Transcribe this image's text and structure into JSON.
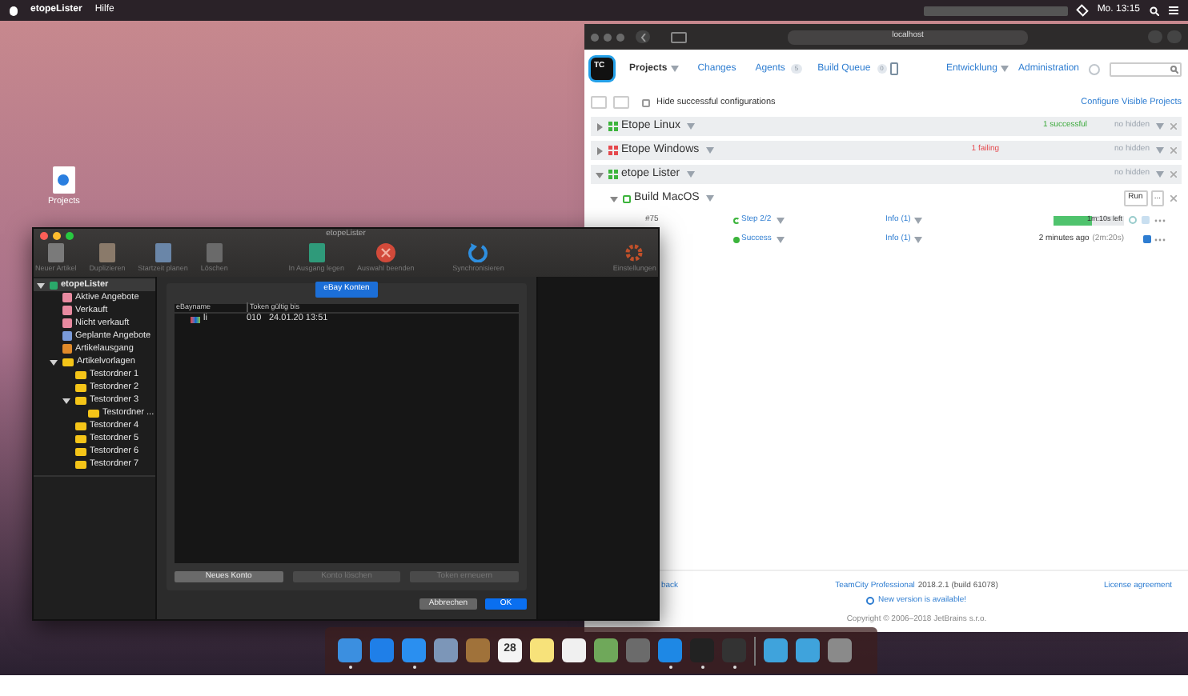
{
  "menu_bar": {
    "app": "etopeLister",
    "items": [
      "Hilfe"
    ],
    "clock": "Mo. 13:15"
  },
  "desktop_icon": {
    "label": "Projects"
  },
  "browser": {
    "address": "localhost",
    "logo": "TC",
    "nav": [
      {
        "label": "Projects",
        "selected": true,
        "dropdown": true
      },
      {
        "label": "Changes",
        "selected": false,
        "dropdown": false
      },
      {
        "label": "Agents",
        "selected": false,
        "dropdown": false,
        "badge": "5"
      },
      {
        "label": "Build Queue",
        "selected": false,
        "dropdown": false,
        "badge": "0"
      }
    ],
    "nav_right": [
      {
        "label": "Entwicklung",
        "dropdown": true
      },
      {
        "label": "Administration",
        "dropdown": false
      }
    ],
    "hide_successful": {
      "label": "Hide successful configurations",
      "checked": false
    },
    "configure_link": "Configure Visible Projects",
    "projects": [
      {
        "name": "Etope Linux",
        "kind": "success",
        "status": "1 successful",
        "hidden": "no hidden",
        "expanded": false
      },
      {
        "name": "Etope Windows",
        "kind": "failing",
        "status": "1 failing",
        "hidden": "no hidden",
        "expanded": false
      },
      {
        "name": "etope Lister",
        "kind": "success",
        "hidden": "no hidden",
        "expanded": true
      }
    ],
    "build_config": {
      "name": "Build MacOS",
      "run": "Run",
      "more": "...",
      "expanded": true
    },
    "builds": [
      {
        "number": "#75",
        "status": "Step 2/2",
        "kind": "running",
        "info": "Info (1)",
        "progress_text": "1m:10s left",
        "level": 0.55
      },
      {
        "status": "Success",
        "kind": "success",
        "info": "Info (1)",
        "time": "2 minutes ago",
        "duration": "(2m:20s)"
      }
    ],
    "footer": {
      "left": "back",
      "product": "TeamCity Professional",
      "version": "2018.2.1 (build 61078)",
      "update": "New version is available!",
      "copyright": "Copyright © 2006–2018 JetBrains s.r.o.",
      "license": "License agreement"
    }
  },
  "app_window": {
    "title": "etopeLister",
    "toolbar": [
      "Neuer Artikel",
      "Duplizieren",
      "Startzeit planen",
      "Löschen",
      "In Ausgang legen",
      "Auswahl beenden",
      "Synchronisieren",
      "Einstellungen"
    ],
    "sidebar": [
      {
        "label": "etopeLister",
        "kind": "app",
        "selected": true,
        "expanded": true,
        "children": [
          {
            "label": "Aktive Angebote",
            "kind": "listing",
            "selected": false
          },
          {
            "label": "Verkauft",
            "kind": "listing",
            "selected": false
          },
          {
            "label": "Nicht verkauft",
            "kind": "listing",
            "selected": false
          },
          {
            "label": "Geplante Angebote",
            "kind": "scheduled",
            "selected": false
          },
          {
            "label": "Artikelausgang",
            "kind": "outbox",
            "selected": false
          },
          {
            "label": "Artikelvorlagen",
            "kind": "folder",
            "selected": false,
            "expanded": true,
            "children": [
              {
                "label": "Testordner 1",
                "kind": "folder",
                "selected": false
              },
              {
                "label": "Testordner 2",
                "kind": "folder",
                "selected": false
              },
              {
                "label": "Testordner 3",
                "kind": "folder",
                "selected": false,
                "expanded": true,
                "children": [
                  {
                    "label": "Testordner ...",
                    "kind": "folder",
                    "selected": false
                  }
                ]
              },
              {
                "label": "Testordner 4",
                "kind": "folder",
                "selected": false
              },
              {
                "label": "Testordner 5",
                "kind": "folder",
                "selected": false
              },
              {
                "label": "Testordner 6",
                "kind": "folder",
                "selected": false
              },
              {
                "label": "Testordner 7",
                "kind": "folder",
                "selected": false
              }
            ]
          }
        ]
      }
    ],
    "sheet": {
      "tab": "eBay Konten",
      "columns": [
        "eBayname",
        "Token gültig bis"
      ],
      "rows": [
        {
          "name": "li",
          "code": "010",
          "valid_until": "24.01.20 13:51"
        }
      ],
      "buttons": [
        {
          "label": "Neues Konto",
          "disabled": false
        },
        {
          "label": "Konto löschen",
          "disabled": true
        },
        {
          "label": "Token erneuern",
          "disabled": true
        }
      ],
      "cancel": "Abbrechen",
      "ok": "OK"
    }
  },
  "dock": [
    {
      "color": "#3b8fe0",
      "running": true
    },
    {
      "color": "#1f7fe8",
      "running": false
    },
    {
      "color": "#2a8ff0",
      "running": true
    },
    {
      "color": "#7c96b8",
      "running": false
    },
    {
      "color": "#a0723a",
      "running": false
    },
    {
      "color": "#f4f4f4",
      "running": false,
      "label": "28"
    },
    {
      "color": "#f7e27a",
      "running": false
    },
    {
      "color": "#f0f0f0",
      "running": false
    },
    {
      "color": "#6fa85a",
      "running": false
    },
    {
      "color": "#6b6b6b",
      "running": false
    },
    {
      "color": "#1e88e5",
      "running": true
    },
    {
      "color": "#222222",
      "running": true
    },
    {
      "color": "#333333",
      "running": true
    },
    {
      "color": "#3fa3dc",
      "running": false
    },
    {
      "color": "#3fa3dc",
      "running": false
    },
    {
      "color": "#8a8a8a",
      "running": false
    }
  ]
}
